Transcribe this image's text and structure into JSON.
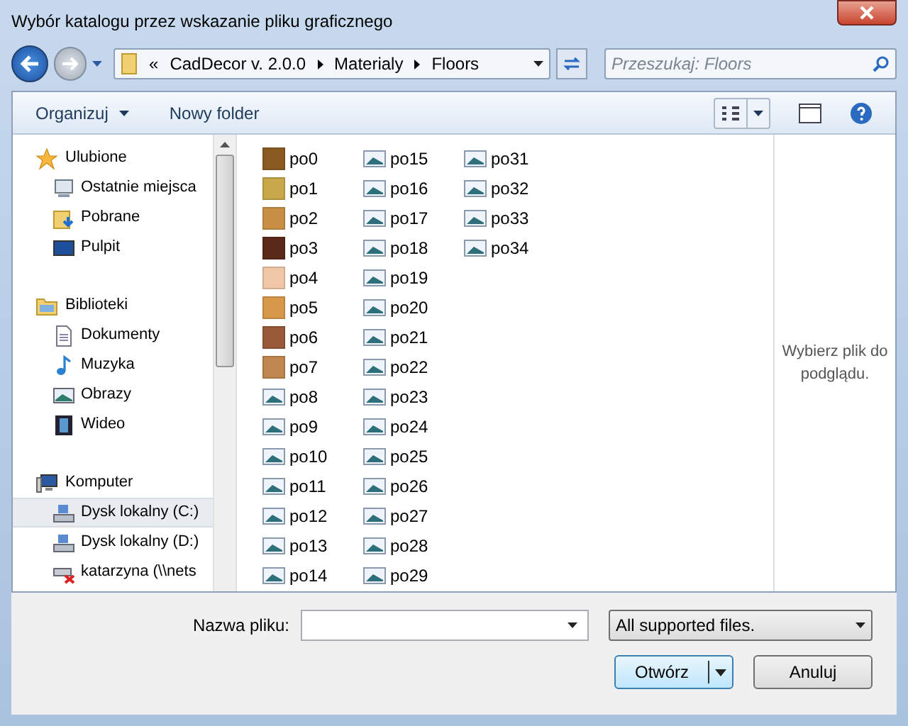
{
  "window": {
    "title": "Wybór katalogu przez wskazanie pliku graficznego"
  },
  "address": {
    "overflow": "«",
    "path": [
      "CadDecor v. 2.0.0",
      "Materialy",
      "Floors"
    ]
  },
  "search": {
    "placeholder": "Przeszukaj: Floors"
  },
  "toolbar": {
    "organize": "Organizuj",
    "new_folder": "Nowy folder"
  },
  "sidebar": {
    "groups": [
      {
        "label": "Ulubione",
        "children": [
          {
            "label": "Ostatnie miejsca",
            "selected": false
          },
          {
            "label": "Pobrane",
            "selected": false
          },
          {
            "label": "Pulpit",
            "selected": false
          }
        ]
      },
      {
        "label": "Biblioteki",
        "children": [
          {
            "label": "Dokumenty",
            "selected": false
          },
          {
            "label": "Muzyka",
            "selected": false
          },
          {
            "label": "Obrazy",
            "selected": false
          },
          {
            "label": "Wideo",
            "selected": false
          }
        ]
      },
      {
        "label": "Komputer",
        "children": [
          {
            "label": "Dysk lokalny (C:)",
            "selected": true
          },
          {
            "label": "Dysk lokalny (D:)",
            "selected": false
          },
          {
            "label": "katarzyna (\\\\nets",
            "selected": false
          }
        ]
      }
    ]
  },
  "files": [
    {
      "name": "po0",
      "kind": "texture",
      "color": "#8a5a22"
    },
    {
      "name": "po1",
      "kind": "texture",
      "color": "#c9a84a"
    },
    {
      "name": "po2",
      "kind": "texture",
      "color": "#c98f45"
    },
    {
      "name": "po3",
      "kind": "texture",
      "color": "#5a2a18"
    },
    {
      "name": "po4",
      "kind": "texture",
      "color": "#f0c8a8"
    },
    {
      "name": "po5",
      "kind": "texture",
      "color": "#d69a4a"
    },
    {
      "name": "po6",
      "kind": "texture",
      "color": "#9a5a3a"
    },
    {
      "name": "po7",
      "kind": "texture",
      "color": "#c08850"
    },
    {
      "name": "po8",
      "kind": "image"
    },
    {
      "name": "po9",
      "kind": "image"
    },
    {
      "name": "po10",
      "kind": "image"
    },
    {
      "name": "po11",
      "kind": "image"
    },
    {
      "name": "po12",
      "kind": "image"
    },
    {
      "name": "po13",
      "kind": "image"
    },
    {
      "name": "po14",
      "kind": "image"
    },
    {
      "name": "po15",
      "kind": "image"
    },
    {
      "name": "po16",
      "kind": "image"
    },
    {
      "name": "po17",
      "kind": "image"
    },
    {
      "name": "po18",
      "kind": "image"
    },
    {
      "name": "po19",
      "kind": "image"
    },
    {
      "name": "po20",
      "kind": "image"
    },
    {
      "name": "po21",
      "kind": "image"
    },
    {
      "name": "po22",
      "kind": "image"
    },
    {
      "name": "po23",
      "kind": "image"
    },
    {
      "name": "po24",
      "kind": "image"
    },
    {
      "name": "po25",
      "kind": "image"
    },
    {
      "name": "po26",
      "kind": "image"
    },
    {
      "name": "po27",
      "kind": "image"
    },
    {
      "name": "po28",
      "kind": "image"
    },
    {
      "name": "po29",
      "kind": "image"
    },
    {
      "name": "po31",
      "kind": "image"
    },
    {
      "name": "po32",
      "kind": "image"
    },
    {
      "name": "po33",
      "kind": "image"
    },
    {
      "name": "po34",
      "kind": "image"
    }
  ],
  "preview": {
    "message": "Wybierz plik do podglądu."
  },
  "footer": {
    "filename_label": "Nazwa pliku:",
    "filter": "All supported files.",
    "open": "Otwórz",
    "cancel": "Anuluj"
  }
}
